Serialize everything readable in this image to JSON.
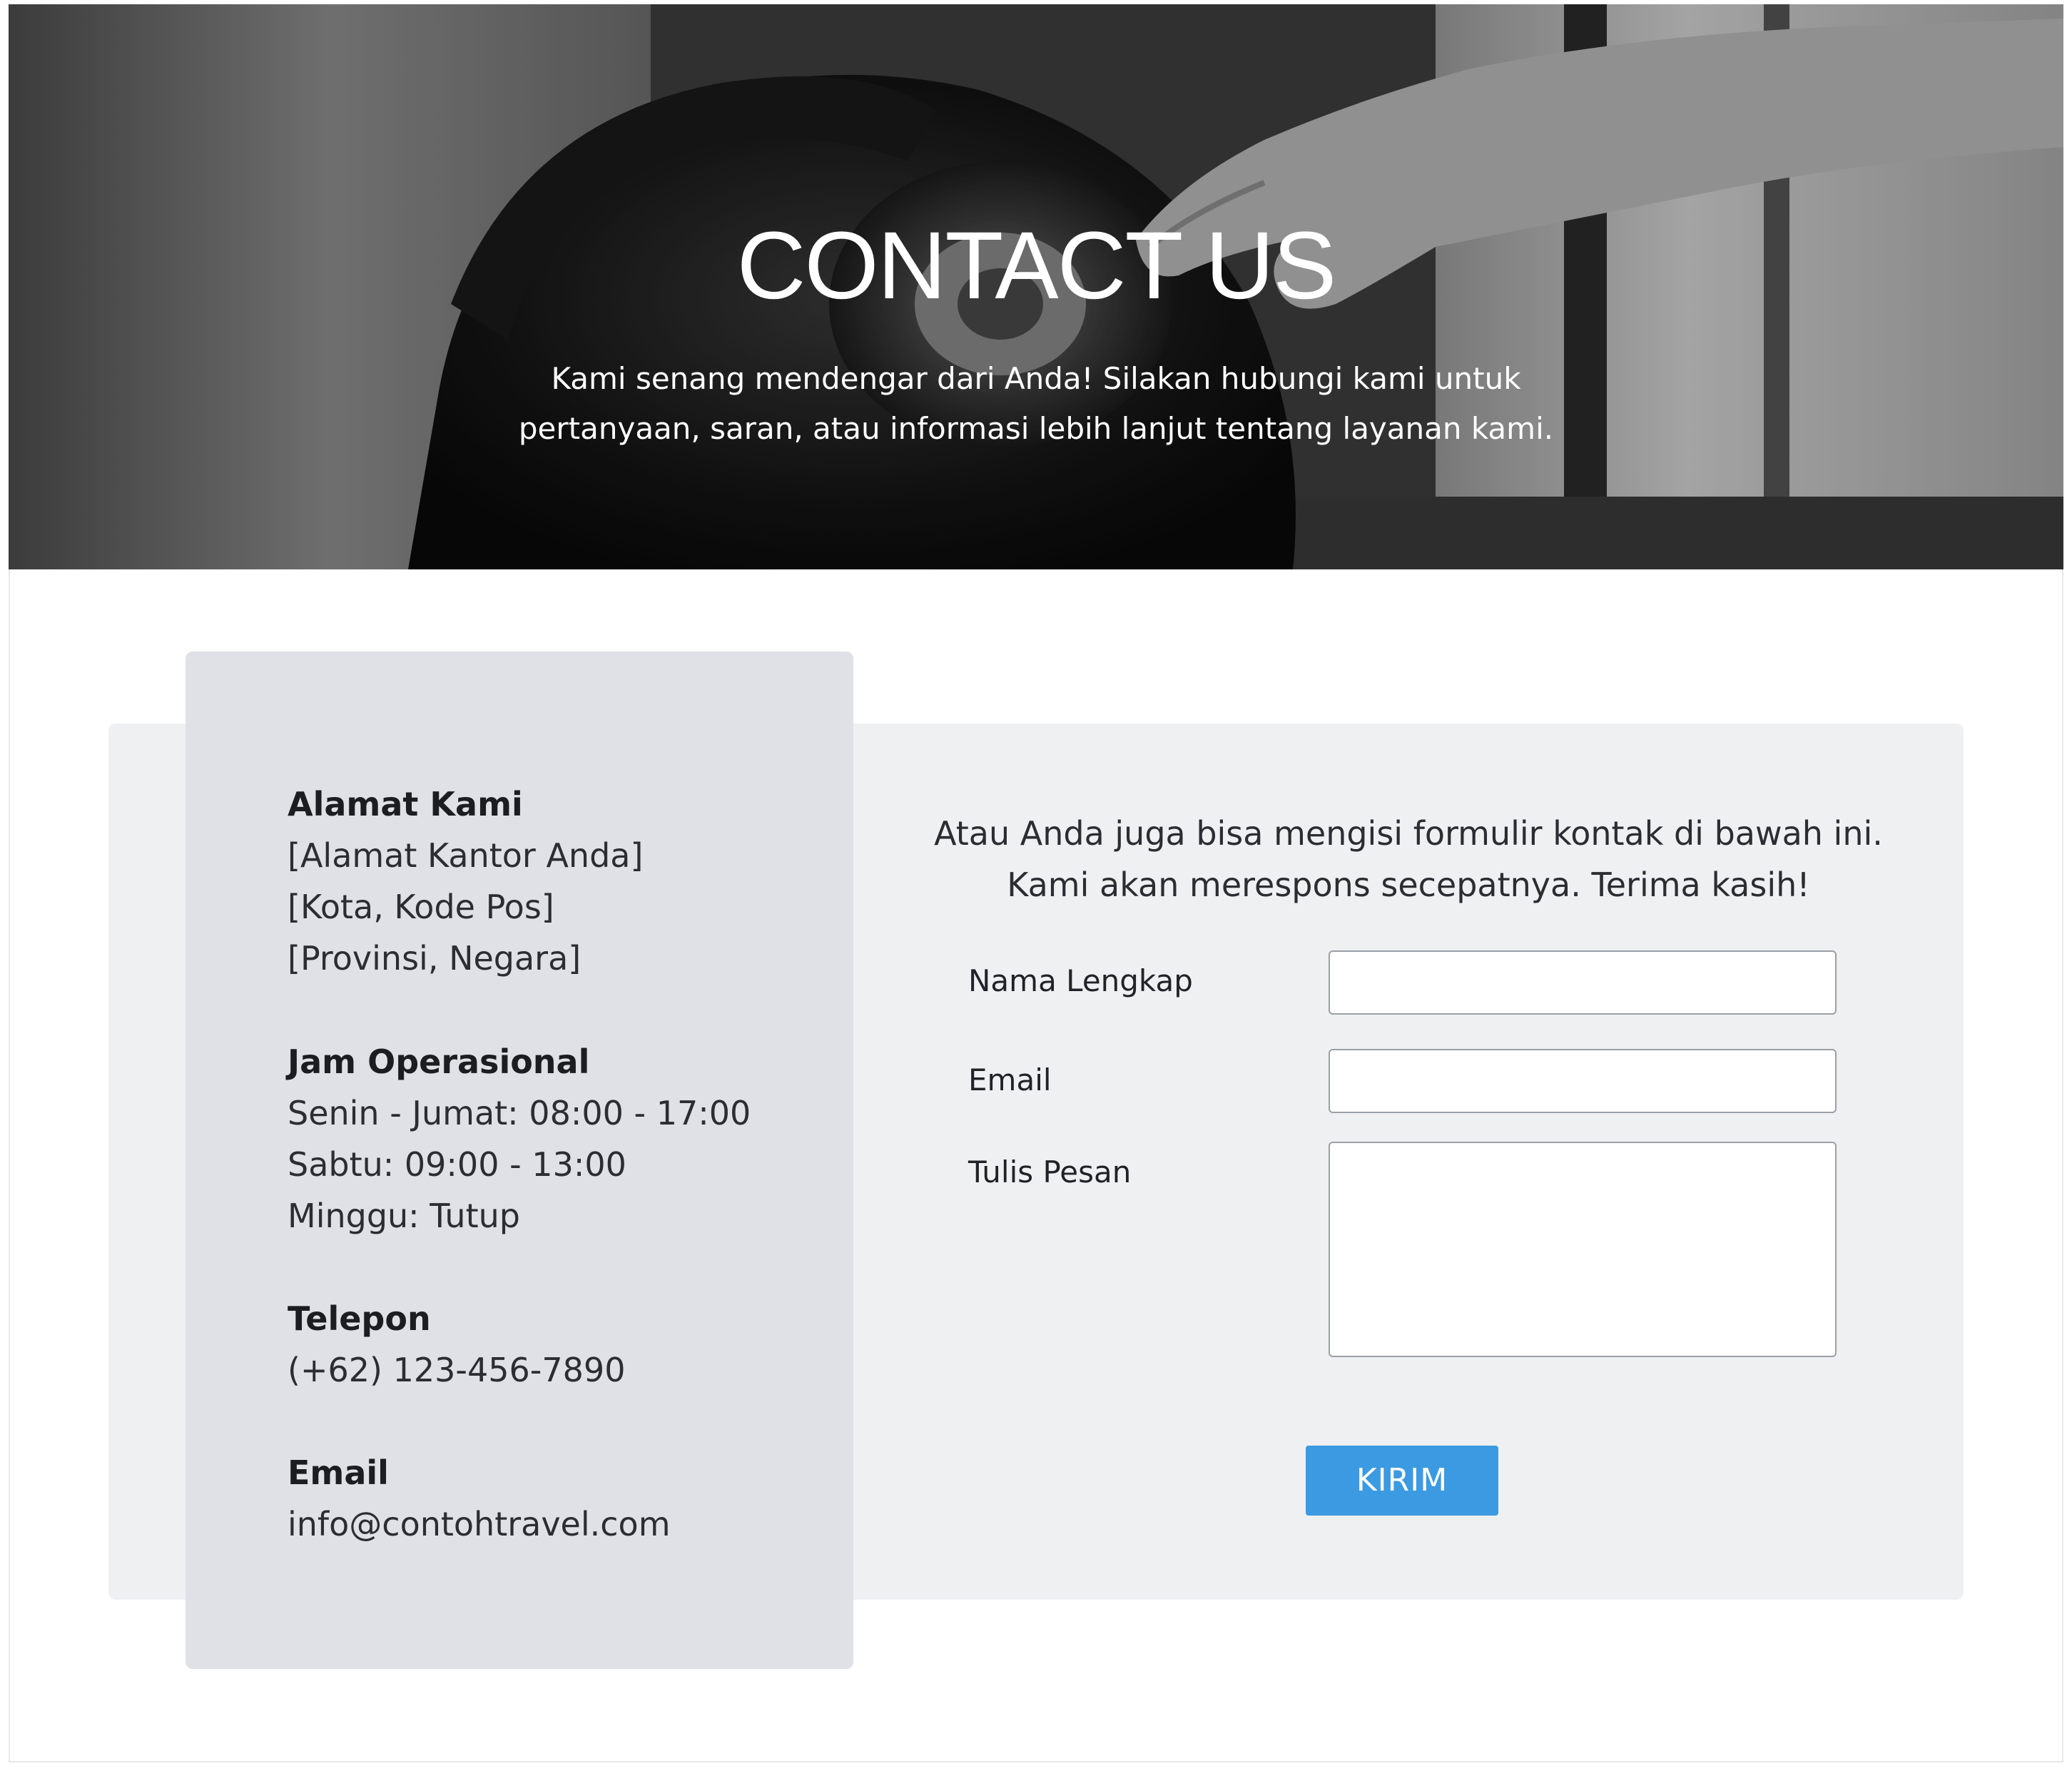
{
  "hero": {
    "title": "CONTACT US",
    "subtitle_line1": "Kami senang mendengar dari Anda! Silakan hubungi kami untuk",
    "subtitle_line2": "pertanyaan, saran, atau informasi lebih lanjut tentang layanan kami."
  },
  "info": {
    "address": {
      "heading": "Alamat Kami",
      "lines": [
        "[Alamat Kantor Anda]",
        "[Kota, Kode Pos]",
        "[Provinsi, Negara]"
      ]
    },
    "hours": {
      "heading": "Jam Operasional",
      "lines": [
        "Senin - Jumat: 08:00 - 17:00",
        "Sabtu: 09:00 - 13:00",
        "Minggu: Tutup"
      ]
    },
    "phone": {
      "heading": "Telepon",
      "value": "(+62) 123-456-7890"
    },
    "email": {
      "heading": "Email",
      "value": "info@contohtravel.com"
    }
  },
  "form": {
    "intro_line1": "Atau Anda juga bisa mengisi formulir kontak di bawah ini.",
    "intro_line2": "Kami akan merespons secepatnya. Terima kasih!",
    "name_label": "Nama Lengkap",
    "name_value": "",
    "email_label": "Email",
    "email_value": "",
    "message_label": "Tulis Pesan",
    "message_value": "",
    "submit_label": "KIRIM"
  },
  "colors": {
    "accent": "#3b9ae1",
    "info_panel": "#dfe1e6",
    "form_panel": "#eff0f2"
  }
}
